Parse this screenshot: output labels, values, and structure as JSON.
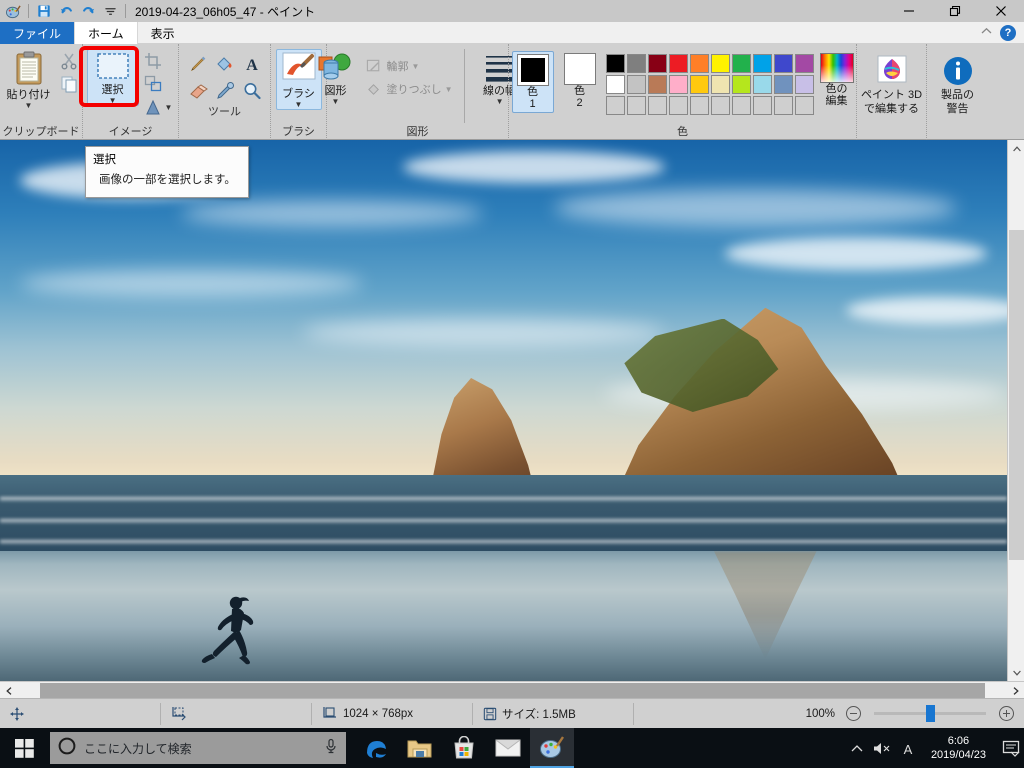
{
  "window": {
    "title": "2019-04-23_06h05_47 - ペイント",
    "app_icon": "paint-icon",
    "quick_access": [
      {
        "name": "save-icon",
        "label": "保存"
      },
      {
        "name": "undo-icon",
        "label": "元に戻す"
      },
      {
        "name": "redo-icon",
        "label": "やり直し"
      },
      {
        "name": "customize-qat-icon",
        "label": "クイック アクセス ツール バーのユーザー設定"
      }
    ],
    "controls": {
      "minimize": "最小化",
      "restore": "元に戻す (縮小)",
      "close": "閉じる",
      "collapse_ribbon": "リボンの最小化",
      "help": "?"
    }
  },
  "tabs": [
    {
      "id": "file",
      "label": "ファイル",
      "active": false
    },
    {
      "id": "home",
      "label": "ホーム",
      "active": true
    },
    {
      "id": "view",
      "label": "表示",
      "active": false
    }
  ],
  "ribbon": {
    "groups": [
      {
        "id": "clipboard",
        "label": "クリップボード",
        "big": {
          "label": "貼り付け",
          "icon": "clipboard-icon",
          "has_dropdown": true
        },
        "small": [
          {
            "label": "切り取り",
            "icon": "scissors-icon",
            "show_label": false
          },
          {
            "label": "コピー",
            "icon": "copy-icon",
            "show_label": false
          }
        ]
      },
      {
        "id": "image",
        "label": "イメージ",
        "big": {
          "label": "選択",
          "icon": "selection-icon",
          "has_dropdown": true,
          "highlighted": true
        },
        "small": [
          {
            "label": "トリミング",
            "icon": "crop-icon",
            "show_label": false
          },
          {
            "label": "サイズ変更",
            "icon": "resize-icon",
            "show_label": false
          },
          {
            "label": "回転",
            "icon": "rotate-icon",
            "show_label": false,
            "has_dropdown": true
          }
        ]
      },
      {
        "id": "tools",
        "label": "ツール",
        "tools": [
          {
            "label": "鉛筆",
            "icon": "pencil-icon"
          },
          {
            "label": "色の塗りつぶし",
            "icon": "fill-bucket-icon"
          },
          {
            "label": "テキスト",
            "icon": "text-a-icon"
          },
          {
            "label": "消しゴム",
            "icon": "eraser-icon"
          },
          {
            "label": "色の選択",
            "icon": "eyedropper-icon"
          },
          {
            "label": "拡大鏡",
            "icon": "magnifier-icon"
          }
        ]
      },
      {
        "id": "brushes",
        "label": "ブラシ",
        "big": {
          "label": "ブラシ",
          "icon": "brush-icon",
          "has_dropdown": true,
          "selected": true
        }
      },
      {
        "id": "shapes",
        "label": "図形",
        "big": {
          "label": "図形",
          "icon": "shapes-icon",
          "has_dropdown": true
        },
        "small": [
          {
            "label": "輪郭",
            "icon": "outline-icon",
            "disabled": true,
            "has_dropdown": true
          },
          {
            "label": "塗りつぶし",
            "icon": "fill-icon",
            "disabled": true,
            "has_dropdown": true
          }
        ],
        "linewidth": {
          "label": "線の幅",
          "icon": "line-width-icon",
          "has_dropdown": true
        }
      },
      {
        "id": "colors",
        "label": "色",
        "color1": {
          "label_line1": "色",
          "label_line2": "1",
          "value": "#000000",
          "selected": true
        },
        "color2": {
          "label_line1": "色",
          "label_line2": "2",
          "value": "#ffffff",
          "selected": false
        },
        "palette_row1": [
          "#000000",
          "#7f7f7f",
          "#880015",
          "#ed1c24",
          "#ff7f27",
          "#fff200",
          "#22b14c",
          "#00a2e8",
          "#3f48cc",
          "#a349a4"
        ],
        "palette_row2": [
          "#ffffff",
          "#c3c3c3",
          "#b97a57",
          "#ffaec9",
          "#ffc90e",
          "#efe4b0",
          "#b5e61d",
          "#99d9ea",
          "#7092be",
          "#c8bfe7"
        ],
        "palette_row3": [
          "",
          "",
          "",
          "",
          "",
          "",
          "",
          "",
          "",
          ""
        ],
        "edit_colors": {
          "label_line1": "色の",
          "label_line2": "編集",
          "icon": "rainbow-palette-icon"
        }
      },
      {
        "id": "paint3d",
        "label": "",
        "big": {
          "label_line1": "ペイント 3D",
          "label_line2": "で編集する",
          "icon": "paint3d-icon"
        }
      },
      {
        "id": "notice",
        "label": "",
        "big": {
          "label_line1": "製品の",
          "label_line2": "警告",
          "icon": "info-icon"
        }
      }
    ]
  },
  "tooltip": {
    "title": "選択",
    "body": "画像の一部を選択します。"
  },
  "canvas": {
    "description": "Wharariki Beach 風景写真 (Windows 10 既定の壁紙)",
    "zoom_annotation": "選択ボタンを囲む赤い注釈枠"
  },
  "statusbar": {
    "cursor_icon": "cursor-position-icon",
    "cursor_value": "",
    "selection_icon": "selection-size-icon",
    "selection_value": "",
    "image_size_icon": "image-size-icon",
    "image_size": "1024 × 768px",
    "file_size_icon": "save-disk-icon",
    "file_size": "サイズ: 1.5MB",
    "zoom_level": "100%",
    "zoom_out_label": "縮小",
    "zoom_in_label": "拡大"
  },
  "scrollbars": {
    "vertical_up": "▲",
    "vertical_down": "▼",
    "horizontal_left": "◀",
    "horizontal_right": "▶"
  },
  "taskbar": {
    "start_label": "スタート",
    "search_placeholder": "ここに入力して検索",
    "cortana_icon": "cortana-circle-icon",
    "mic_icon": "microphone-icon",
    "apps": [
      {
        "name": "edge-icon",
        "label": "Microsoft Edge",
        "active": false
      },
      {
        "name": "file-explorer-icon",
        "label": "エクスプローラー",
        "active": false
      },
      {
        "name": "microsoft-store-icon",
        "label": "Microsoft Store",
        "active": false
      },
      {
        "name": "mail-icon",
        "label": "メール",
        "active": false
      },
      {
        "name": "paint-taskbar-icon",
        "label": "ペイント",
        "active": true
      }
    ],
    "tray": {
      "chevron_icon": "show-hidden-icons-icon",
      "volume_icon": "volume-muted-icon",
      "ime_icon": "A",
      "time": "6:06",
      "date": "2019/04/23",
      "action_center_icon": "action-center-icon"
    }
  }
}
